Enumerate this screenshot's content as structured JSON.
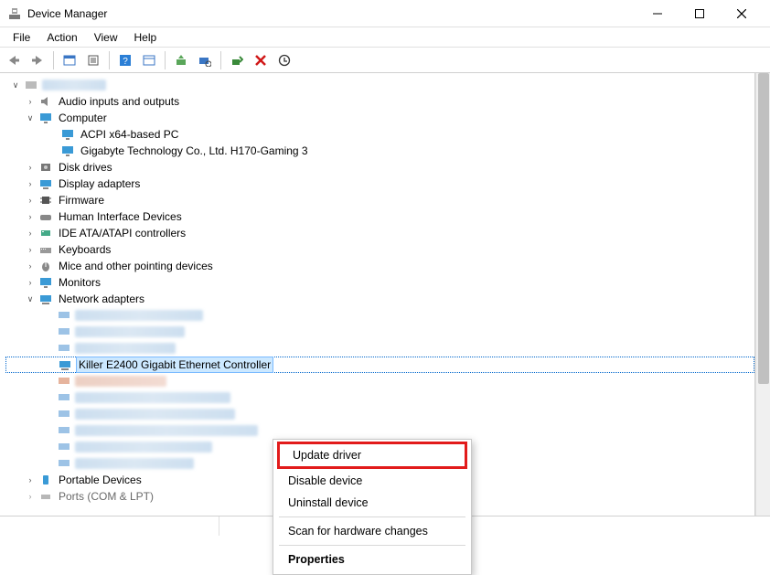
{
  "window": {
    "title": "Device Manager"
  },
  "menu": {
    "file": "File",
    "action": "Action",
    "view": "View",
    "help": "Help"
  },
  "tree": {
    "root_blurred": true,
    "audio": "Audio inputs and outputs",
    "computer": "Computer",
    "computer_children": {
      "acpi": "ACPI x64-based PC",
      "gigabyte": "Gigabyte Technology Co., Ltd. H170-Gaming 3"
    },
    "disk": "Disk drives",
    "display": "Display adapters",
    "firmware": "Firmware",
    "hid": "Human Interface Devices",
    "ide": "IDE ATA/ATAPI controllers",
    "keyboards": "Keyboards",
    "mice": "Mice and other pointing devices",
    "monitors": "Monitors",
    "network": "Network adapters",
    "network_selected": "Killer E2400 Gigabit Ethernet Controller",
    "portable": "Portable Devices",
    "ports_partial": "Ports (COM & LPT)"
  },
  "context_menu": {
    "update": "Update driver",
    "disable": "Disable device",
    "uninstall": "Uninstall device",
    "scan": "Scan for hardware changes",
    "properties": "Properties"
  }
}
